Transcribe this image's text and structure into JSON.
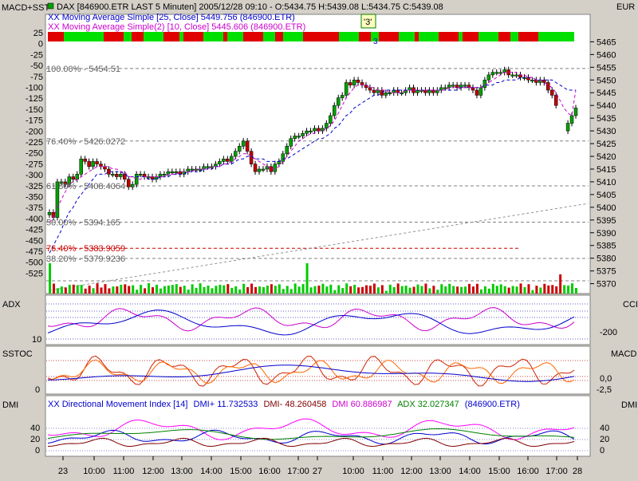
{
  "header": {
    "left_panel_label": "MACD+SST",
    "instrument": "DAX [846900.ETR LAST 5 Minuten] 2005/12/28 09:10 - O:5434.75 H:5439.08 L:5434.75 C:5439.08",
    "currency": "EUR",
    "ma1_legend": "XX Moving Average Simple [25, Close] 5449.756 (846900.ETR)",
    "ma2_legend": "XX Moving Average Simple(2) [10, Close] 5445.606 (846900.ETR)",
    "marker": "'3'",
    "marker_sub": "3"
  },
  "colors": {
    "panel_bg": "#ffffff",
    "frame_bg": "#d4d0c8",
    "up": "#00a000",
    "down": "#c00000",
    "ma1": "#0000cc",
    "ma2": "#cc00cc",
    "volume_up": "#00cc00",
    "volume_down": "#cc0000",
    "fib_gray": "#808080",
    "fib_red": "#cc0000",
    "strip_green": "#00e000",
    "strip_red": "#e00000",
    "adx": "#0000cc",
    "cci": "#cc00cc",
    "sstoc_k": "#cc2200",
    "sstoc_d": "#0000cc",
    "dmi_plus": "#800000",
    "dmi_minus": "#ff00ff",
    "dmi_adx": "#008000",
    "dmi_blue": "#0000cc"
  },
  "main_panel": {
    "price_ticks": [
      "5465",
      "5460",
      "5455",
      "5450",
      "5445",
      "5440",
      "5435",
      "5430",
      "5425",
      "5420",
      "5415",
      "5410",
      "5405",
      "5400",
      "5395",
      "5390",
      "5385",
      "5380",
      "5375",
      "5370"
    ],
    "left_ticks": [
      "25",
      "0",
      "-25",
      "-50",
      "-75",
      "-100",
      "-125",
      "-150",
      "-175",
      "-200",
      "-225",
      "-250",
      "-275",
      "-300",
      "-325",
      "-350",
      "-375",
      "-400",
      "-425",
      "-450",
      "-475",
      "-500",
      "-525"
    ]
  },
  "fib_labels": [
    {
      "text": "100.00% - 5454.51",
      "price": 5454.51,
      "color": "gray"
    },
    {
      "text": "76.40% - 5426.0272",
      "price": 5426.0272,
      "color": "gray"
    },
    {
      "text": "61.80% - 5408.4064",
      "price": 5408.4064,
      "color": "gray"
    },
    {
      "text": "50.00% - 5394.165",
      "price": 5394.165,
      "color": "gray"
    },
    {
      "text": "76.40% - 5383.9059",
      "price": 5383.9059,
      "color": "red"
    },
    {
      "text": "38.20% - 5379.9236",
      "price": 5379.9236,
      "color": "gray"
    }
  ],
  "adx_panel": {
    "left_label": "ADX",
    "right_label": "CCI",
    "left_tick": "10",
    "right_tick": "-200"
  },
  "sstoc_panel": {
    "left_label": "SSTOC",
    "right_label": "MACD",
    "left_tick": "0",
    "right_ticks": [
      "0,0",
      "-2,5"
    ]
  },
  "dmi_panel": {
    "left_label": "DMI",
    "right_label": "DMI",
    "legend_title": "XX Directional Movement Index [14]",
    "legend_plus": "DMI+ 11.732533",
    "legend_minus": "DMI- 48.260458",
    "legend_dmi": "DMI 60.886987",
    "legend_adx": "ADX 32.027347",
    "legend_sym": "(846900.ETR)",
    "left_ticks": [
      "40",
      "20",
      "0"
    ],
    "right_ticks": [
      "40",
      "20",
      "0"
    ]
  },
  "time_axis": [
    "23",
    "10:00",
    "11:00",
    "12:00",
    "13:00",
    "14:00",
    "15:00",
    "16:00",
    "17:00",
    "27",
    "10:00",
    "11:00",
    "12:00",
    "13:00",
    "14:00",
    "15:00",
    "16:00",
    "17:00",
    "28"
  ],
  "chart_data": {
    "type": "line",
    "title": "DAX [846900.ETR LAST 5 Minuten] 2005/12/28 09:10 - O:5434.75 H:5439.08 L:5434.75 C:5439.08",
    "ylabel": "EUR",
    "ylim": [
      5368,
      5467
    ],
    "x": [
      0,
      5,
      10,
      15,
      20,
      25,
      30,
      35,
      40,
      45,
      50,
      55,
      60,
      65,
      70,
      75,
      80,
      85,
      90,
      95,
      100,
      105,
      110,
      115,
      120,
      125,
      130,
      135,
      140,
      145,
      150,
      155,
      160,
      165,
      170,
      175,
      180,
      185,
      190,
      195,
      200,
      205,
      210,
      215,
      220,
      225,
      230,
      235,
      240,
      245,
      250,
      255,
      260,
      265,
      270,
      275,
      280,
      285,
      290,
      295,
      300,
      305,
      310,
      315,
      320,
      325,
      330,
      335,
      340,
      345,
      350,
      355,
      360,
      365,
      370,
      375,
      380,
      385,
      390,
      395,
      400,
      405,
      410,
      415,
      420,
      425,
      430,
      435,
      440,
      445,
      450,
      455,
      460,
      465,
      470,
      475,
      480,
      485,
      490,
      495,
      500,
      505,
      510,
      515,
      520,
      525,
      530,
      535,
      540,
      545,
      550,
      555,
      560,
      565,
      570,
      575,
      580,
      585,
      590,
      595,
      600,
      605,
      610,
      615,
      620,
      625,
      630,
      635,
      640,
      645,
      650,
      655,
      660,
      665
    ],
    "series": [
      {
        "name": "DAX",
        "values": [
          5398,
          5396,
          5410,
          5410,
          5409,
          5412,
          5411,
          5413,
          5419,
          5418,
          5416,
          5418,
          5417,
          5416,
          5415,
          5413,
          5413,
          5412,
          5413,
          5411,
          5408,
          5409,
          5413,
          5413,
          5412,
          5412,
          5411,
          5412,
          5413,
          5413,
          5414,
          5414,
          5414,
          5413,
          5414,
          5415,
          5415,
          5415,
          5415,
          5416,
          5416,
          5416,
          5417,
          5418,
          5419,
          5418,
          5420,
          5422,
          5424,
          5426,
          5422,
          5417,
          5414,
          5415,
          5415,
          5416,
          5414,
          5417,
          5418,
          5421,
          5424,
          5427,
          5428,
          5428,
          5429,
          5430,
          5430,
          5431,
          5430,
          5431,
          5433,
          5436,
          5440,
          5443,
          5444,
          5449,
          5448,
          5450,
          5449,
          5448,
          5447,
          5446,
          5445,
          5446,
          5444,
          5445,
          5445,
          5446,
          5445,
          5445,
          5446,
          5447,
          5445,
          5446,
          5446,
          5445,
          5446,
          5445,
          5446,
          5447,
          5447,
          5448,
          5448,
          5447,
          5448,
          5448,
          5447,
          5446,
          5444,
          5447,
          5450,
          5452,
          5453,
          5453,
          5453,
          5454,
          5452,
          5452,
          5452,
          5451,
          5451,
          5450,
          5450,
          5449,
          5450,
          5449,
          5446,
          5444,
          5440,
          5430,
          5430,
          5433,
          5436,
          5439
        ]
      },
      {
        "name": "XX Moving Average Simple [25, Close] 5449.756 (846900.ETR)",
        "values": [
          5382,
          5385,
          5388,
          5391,
          5395,
          5398,
          5400,
          5403,
          5405,
          5407,
          5409,
          5411,
          5413,
          5413,
          5413,
          5414,
          5414,
          5414,
          5414,
          5413,
          5412,
          5412,
          5412,
          5412,
          5412,
          5411,
          5411,
          5411,
          5412,
          5412,
          5412,
          5413,
          5413,
          5413,
          5413,
          5414,
          5414,
          5414,
          5414,
          5415,
          5415,
          5415,
          5416,
          5416,
          5417,
          5417,
          5417,
          5418,
          5419,
          5419,
          5420,
          5420,
          5419,
          5419,
          5419,
          5418,
          5418,
          5418,
          5418,
          5419,
          5419,
          5420,
          5421,
          5422,
          5423,
          5424,
          5425,
          5426,
          5427,
          5427,
          5428,
          5429,
          5431,
          5432,
          5434,
          5436,
          5437,
          5439,
          5440,
          5441,
          5442,
          5443,
          5444,
          5444,
          5445,
          5446,
          5446,
          5446,
          5446,
          5446,
          5446,
          5446,
          5446,
          5446,
          5446,
          5446,
          5446,
          5446,
          5446,
          5446,
          5446,
          5446,
          5446,
          5446,
          5447,
          5447,
          5447,
          5447,
          5447,
          5447,
          5448,
          5448,
          5448,
          5449,
          5449,
          5450,
          5450,
          5450,
          5450,
          5451,
          5451,
          5451,
          5451,
          5450,
          5450,
          5450,
          5450,
          5450,
          5449,
          5448,
          5447,
          5446,
          5446,
          5446
        ]
      },
      {
        "name": "XX Moving Average Simple(2) [10, Close] 5445.606 (846900.ETR)",
        "values": [
          5394,
          5396,
          5400,
          5403,
          5406,
          5409,
          5410,
          5411,
          5412,
          5413,
          5414,
          5415,
          5416,
          5416,
          5416,
          5416,
          5415,
          5415,
          5414,
          5414,
          5412,
          5412,
          5411,
          5411,
          5412,
          5412,
          5412,
          5412,
          5412,
          5412,
          5413,
          5413,
          5413,
          5414,
          5414,
          5414,
          5414,
          5415,
          5415,
          5415,
          5415,
          5416,
          5416,
          5416,
          5417,
          5417,
          5418,
          5419,
          5420,
          5421,
          5421,
          5420,
          5419,
          5418,
          5417,
          5416,
          5415,
          5415,
          5416,
          5418,
          5420,
          5422,
          5424,
          5426,
          5427,
          5428,
          5429,
          5429,
          5430,
          5430,
          5431,
          5432,
          5434,
          5437,
          5440,
          5443,
          5445,
          5447,
          5448,
          5448,
          5448,
          5447,
          5447,
          5446,
          5446,
          5446,
          5445,
          5445,
          5445,
          5445,
          5446,
          5446,
          5446,
          5446,
          5446,
          5446,
          5446,
          5446,
          5446,
          5446,
          5446,
          5447,
          5447,
          5447,
          5447,
          5447,
          5447,
          5447,
          5447,
          5447,
          5448,
          5449,
          5450,
          5451,
          5452,
          5453,
          5453,
          5453,
          5453,
          5452,
          5452,
          5451,
          5451,
          5450,
          5450,
          5449,
          5448,
          5447,
          5445,
          5442,
          5439,
          5437,
          5436,
          5446
        ]
      }
    ]
  }
}
